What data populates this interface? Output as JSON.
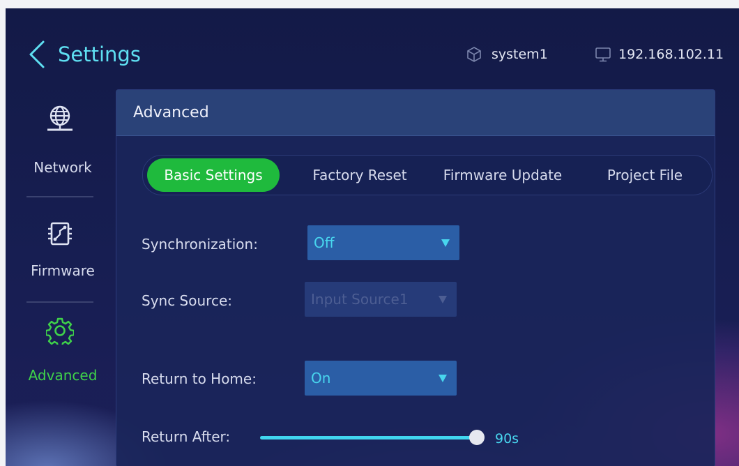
{
  "header": {
    "title": "Settings",
    "system_name": "system1",
    "ip_address": "192.168.102.11"
  },
  "sidebar": {
    "items": [
      {
        "label": "Network",
        "icon": "globe-network-icon"
      },
      {
        "label": "Firmware",
        "icon": "chip-icon"
      },
      {
        "label": "Advanced",
        "icon": "gear-icon",
        "active": true
      }
    ]
  },
  "panel": {
    "title": "Advanced",
    "tabs": [
      {
        "label": "Basic Settings",
        "active": true
      },
      {
        "label": "Factory Reset"
      },
      {
        "label": "Firmware Update"
      },
      {
        "label": "Project File"
      }
    ],
    "fields": {
      "synchronization": {
        "label": "Synchronization:",
        "value": "Off"
      },
      "sync_source": {
        "label": "Sync Source:",
        "value": "Input Source1",
        "disabled": true
      },
      "return_home": {
        "label": "Return to Home:",
        "value": "On"
      },
      "return_after": {
        "label": "Return After:",
        "value": "90s"
      }
    }
  },
  "colors": {
    "accent_cyan": "#5fe0f2",
    "active_green": "#3fd24a",
    "tab_green": "#1fba3d",
    "select_blue": "#2b5ea6"
  }
}
